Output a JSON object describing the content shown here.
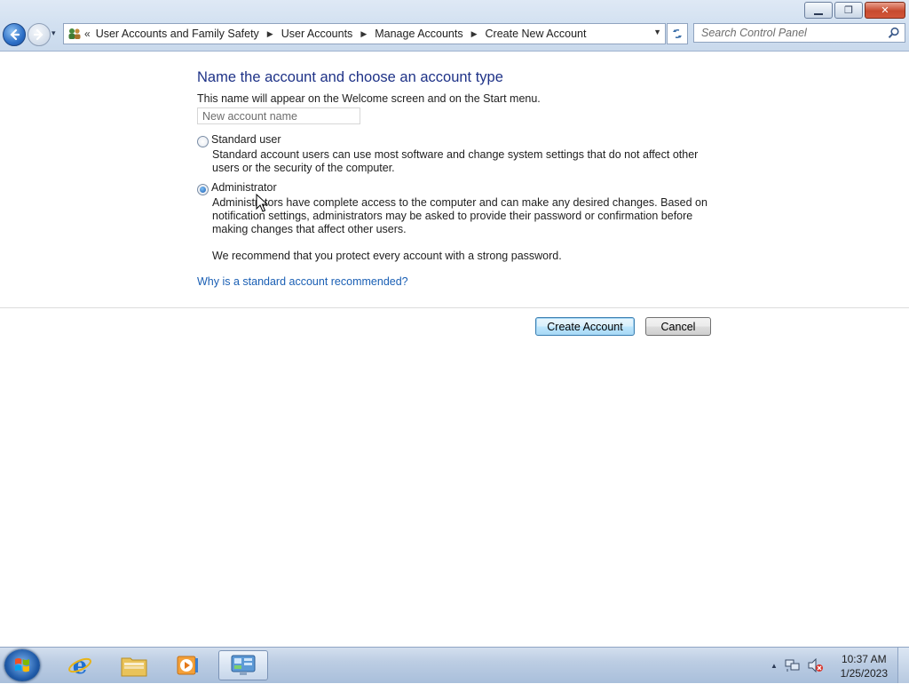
{
  "window": {
    "caption": {
      "minimize": "▭",
      "maximize": "❐",
      "close": "✕"
    }
  },
  "nav": {
    "back": "←",
    "forward": "→",
    "recent": "▾",
    "address_chevron": "«",
    "breadcrumbs": [
      "User Accounts and Family Safety",
      "User Accounts",
      "Manage Accounts",
      "Create New Account"
    ],
    "separator": "▶",
    "dropdown": "▼",
    "search_placeholder": "Search Control Panel"
  },
  "content": {
    "title": "Name the account and choose an account type",
    "subtitle": "This name will appear on the Welcome screen and on the Start menu.",
    "name_placeholder": "New account name",
    "options": [
      {
        "label": "Standard user",
        "description": "Standard account users can use most software and change system settings that do not affect other users or the security of the computer.",
        "selected": false
      },
      {
        "label": "Administrator",
        "description": "Administrators have complete access to the computer and can make any desired changes. Based on notification settings, administrators may be asked to provide their password or confirmation before making changes that affect other users.",
        "selected": true
      }
    ],
    "recommendation": "We recommend that you protect every account with a strong password.",
    "help_link": "Why is a standard account recommended?",
    "create_button": "Create Account",
    "cancel_button": "Cancel"
  },
  "taskbar": {
    "time": "10:37 AM",
    "date": "1/25/2023",
    "tray_arrow": "▲"
  },
  "colors": {
    "title": "#1e3287",
    "link": "#1a5fb4",
    "chrome": "#d3e1f1"
  }
}
